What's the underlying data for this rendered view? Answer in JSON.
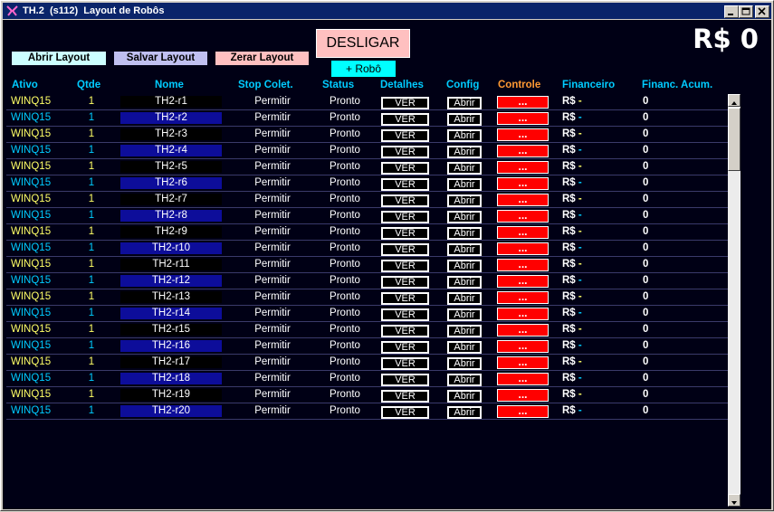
{
  "window": {
    "title": "TH.2  (s112)  Layout de Robôs",
    "app_icon": "app-icon",
    "controls": [
      "minimize-icon",
      "maximize-icon",
      "close-icon"
    ]
  },
  "toolbar": {
    "abrir_layout": "Abrir Layout",
    "salvar_layout": "Salvar Layout",
    "zerar_layout": "Zerar Layout",
    "desligar": "DESLIGAR",
    "add_robo": "+ Robô",
    "total": "R$ 0"
  },
  "colors": {
    "abrir_layout_bg": "#ccffff",
    "salvar_layout_bg": "#c0c0f0",
    "zerar_layout_bg": "#ffc0c0",
    "desligar_bg": "#ffc0c0",
    "add_robo_bg": "#00ffff",
    "header_text": "#00ccff",
    "controle_header": "#ff9933",
    "controle_cell": "#ff0000"
  },
  "table": {
    "headers": {
      "ativo": "Ativo",
      "qtde": "Qtde",
      "nome": "Nome",
      "stop": "Stop Colet.",
      "status": "Status",
      "detalhes": "Detalhes",
      "config": "Config",
      "controle": "Controle",
      "financeiro": "Financeiro",
      "acum": "Financ. Acum."
    },
    "rows": [
      {
        "ativo": "WINQ15",
        "qtde": "1",
        "nome": "TH2-r1",
        "stop": "Permitir",
        "status": "Pronto",
        "detalhes": "VER",
        "config": "Abrir",
        "controle": "...",
        "fin_currency": "R$",
        "fin_value": "-",
        "acum": "0"
      },
      {
        "ativo": "WINQ15",
        "qtde": "1",
        "nome": "TH2-r2",
        "stop": "Permitir",
        "status": "Pronto",
        "detalhes": "VER",
        "config": "Abrir",
        "controle": "...",
        "fin_currency": "R$",
        "fin_value": "-",
        "acum": "0"
      },
      {
        "ativo": "WINQ15",
        "qtde": "1",
        "nome": "TH2-r3",
        "stop": "Permitir",
        "status": "Pronto",
        "detalhes": "VER",
        "config": "Abrir",
        "controle": "...",
        "fin_currency": "R$",
        "fin_value": "-",
        "acum": "0"
      },
      {
        "ativo": "WINQ15",
        "qtde": "1",
        "nome": "TH2-r4",
        "stop": "Permitir",
        "status": "Pronto",
        "detalhes": "VER",
        "config": "Abrir",
        "controle": "...",
        "fin_currency": "R$",
        "fin_value": "-",
        "acum": "0"
      },
      {
        "ativo": "WINQ15",
        "qtde": "1",
        "nome": "TH2-r5",
        "stop": "Permitir",
        "status": "Pronto",
        "detalhes": "VER",
        "config": "Abrir",
        "controle": "...",
        "fin_currency": "R$",
        "fin_value": "-",
        "acum": "0"
      },
      {
        "ativo": "WINQ15",
        "qtde": "1",
        "nome": "TH2-r6",
        "stop": "Permitir",
        "status": "Pronto",
        "detalhes": "VER",
        "config": "Abrir",
        "controle": "...",
        "fin_currency": "R$",
        "fin_value": "-",
        "acum": "0"
      },
      {
        "ativo": "WINQ15",
        "qtde": "1",
        "nome": "TH2-r7",
        "stop": "Permitir",
        "status": "Pronto",
        "detalhes": "VER",
        "config": "Abrir",
        "controle": "...",
        "fin_currency": "R$",
        "fin_value": "-",
        "acum": "0"
      },
      {
        "ativo": "WINQ15",
        "qtde": "1",
        "nome": "TH2-r8",
        "stop": "Permitir",
        "status": "Pronto",
        "detalhes": "VER",
        "config": "Abrir",
        "controle": "...",
        "fin_currency": "R$",
        "fin_value": "-",
        "acum": "0"
      },
      {
        "ativo": "WINQ15",
        "qtde": "1",
        "nome": "TH2-r9",
        "stop": "Permitir",
        "status": "Pronto",
        "detalhes": "VER",
        "config": "Abrir",
        "controle": "...",
        "fin_currency": "R$",
        "fin_value": "-",
        "acum": "0"
      },
      {
        "ativo": "WINQ15",
        "qtde": "1",
        "nome": "TH2-r10",
        "stop": "Permitir",
        "status": "Pronto",
        "detalhes": "VER",
        "config": "Abrir",
        "controle": "...",
        "fin_currency": "R$",
        "fin_value": "-",
        "acum": "0"
      },
      {
        "ativo": "WINQ15",
        "qtde": "1",
        "nome": "TH2-r11",
        "stop": "Permitir",
        "status": "Pronto",
        "detalhes": "VER",
        "config": "Abrir",
        "controle": "...",
        "fin_currency": "R$",
        "fin_value": "-",
        "acum": "0"
      },
      {
        "ativo": "WINQ15",
        "qtde": "1",
        "nome": "TH2-r12",
        "stop": "Permitir",
        "status": "Pronto",
        "detalhes": "VER",
        "config": "Abrir",
        "controle": "...",
        "fin_currency": "R$",
        "fin_value": "-",
        "acum": "0"
      },
      {
        "ativo": "WINQ15",
        "qtde": "1",
        "nome": "TH2-r13",
        "stop": "Permitir",
        "status": "Pronto",
        "detalhes": "VER",
        "config": "Abrir",
        "controle": "...",
        "fin_currency": "R$",
        "fin_value": "-",
        "acum": "0"
      },
      {
        "ativo": "WINQ15",
        "qtde": "1",
        "nome": "TH2-r14",
        "stop": "Permitir",
        "status": "Pronto",
        "detalhes": "VER",
        "config": "Abrir",
        "controle": "...",
        "fin_currency": "R$",
        "fin_value": "-",
        "acum": "0"
      },
      {
        "ativo": "WINQ15",
        "qtde": "1",
        "nome": "TH2-r15",
        "stop": "Permitir",
        "status": "Pronto",
        "detalhes": "VER",
        "config": "Abrir",
        "controle": "...",
        "fin_currency": "R$",
        "fin_value": "-",
        "acum": "0"
      },
      {
        "ativo": "WINQ15",
        "qtde": "1",
        "nome": "TH2-r16",
        "stop": "Permitir",
        "status": "Pronto",
        "detalhes": "VER",
        "config": "Abrir",
        "controle": "...",
        "fin_currency": "R$",
        "fin_value": "-",
        "acum": "0"
      },
      {
        "ativo": "WINQ15",
        "qtde": "1",
        "nome": "TH2-r17",
        "stop": "Permitir",
        "status": "Pronto",
        "detalhes": "VER",
        "config": "Abrir",
        "controle": "...",
        "fin_currency": "R$",
        "fin_value": "-",
        "acum": "0"
      },
      {
        "ativo": "WINQ15",
        "qtde": "1",
        "nome": "TH2-r18",
        "stop": "Permitir",
        "status": "Pronto",
        "detalhes": "VER",
        "config": "Abrir",
        "controle": "...",
        "fin_currency": "R$",
        "fin_value": "-",
        "acum": "0"
      },
      {
        "ativo": "WINQ15",
        "qtde": "1",
        "nome": "TH2-r19",
        "stop": "Permitir",
        "status": "Pronto",
        "detalhes": "VER",
        "config": "Abrir",
        "controle": "...",
        "fin_currency": "R$",
        "fin_value": "-",
        "acum": "0"
      },
      {
        "ativo": "WINQ15",
        "qtde": "1",
        "nome": "TH2-r20",
        "stop": "Permitir",
        "status": "Pronto",
        "detalhes": "VER",
        "config": "Abrir",
        "controle": "...",
        "fin_currency": "R$",
        "fin_value": "-",
        "acum": "0"
      }
    ]
  }
}
